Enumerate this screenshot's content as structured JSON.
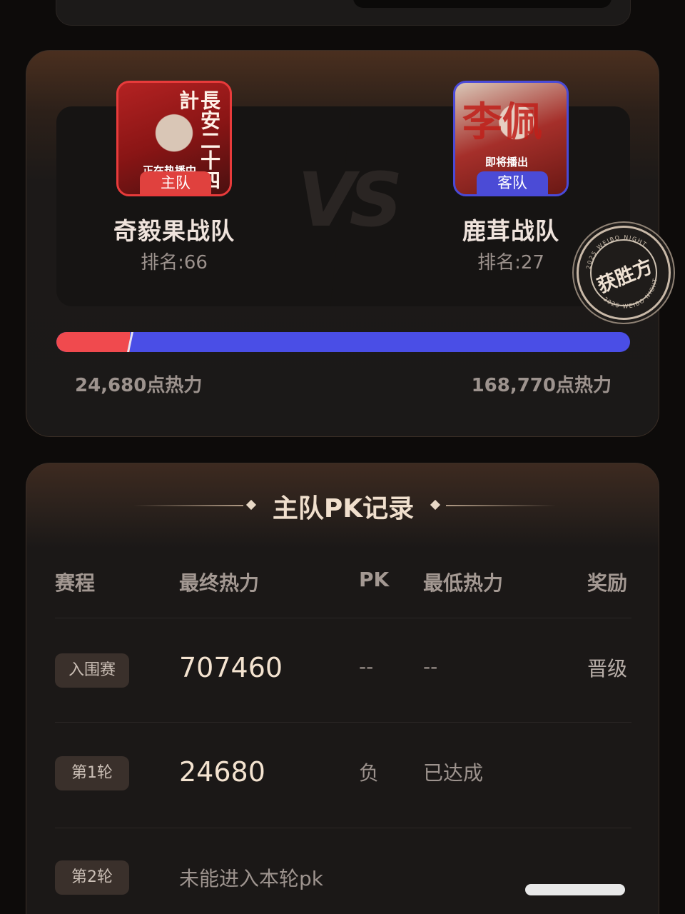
{
  "pk": {
    "home": {
      "tag": "主队",
      "name": "奇毅果战队",
      "rank": "排名:66",
      "heat": "24,680点热力",
      "poster_text": "正在热播中",
      "poster_title": "長安二十四計",
      "color": "#e83b3b"
    },
    "away": {
      "tag": "客队",
      "name": "鹿茸战队",
      "rank": "排名:27",
      "heat": "168,770点热力",
      "poster_text": "即将播出",
      "poster_title": "李佩",
      "color": "#4a4ad8"
    },
    "vs_label": "VS",
    "home_share": 0.128,
    "winner_stamp": {
      "word": "获胜方",
      "arc_text": "2025 WEIBO NIGHT"
    }
  },
  "record": {
    "title": "主队PK记录",
    "headers": [
      "赛程",
      "最终热力",
      "PK",
      "最低热力",
      "奖励"
    ],
    "rows": [
      {
        "stage": "入围赛",
        "final_heat": "707460",
        "pk": "--",
        "min_heat": "--",
        "reward": "晋级"
      },
      {
        "stage": "第1轮",
        "final_heat": "24680",
        "pk": "负",
        "min_heat": "已达成",
        "reward": ""
      },
      {
        "stage": "第2轮",
        "note": "未能进入本轮pk"
      }
    ]
  }
}
